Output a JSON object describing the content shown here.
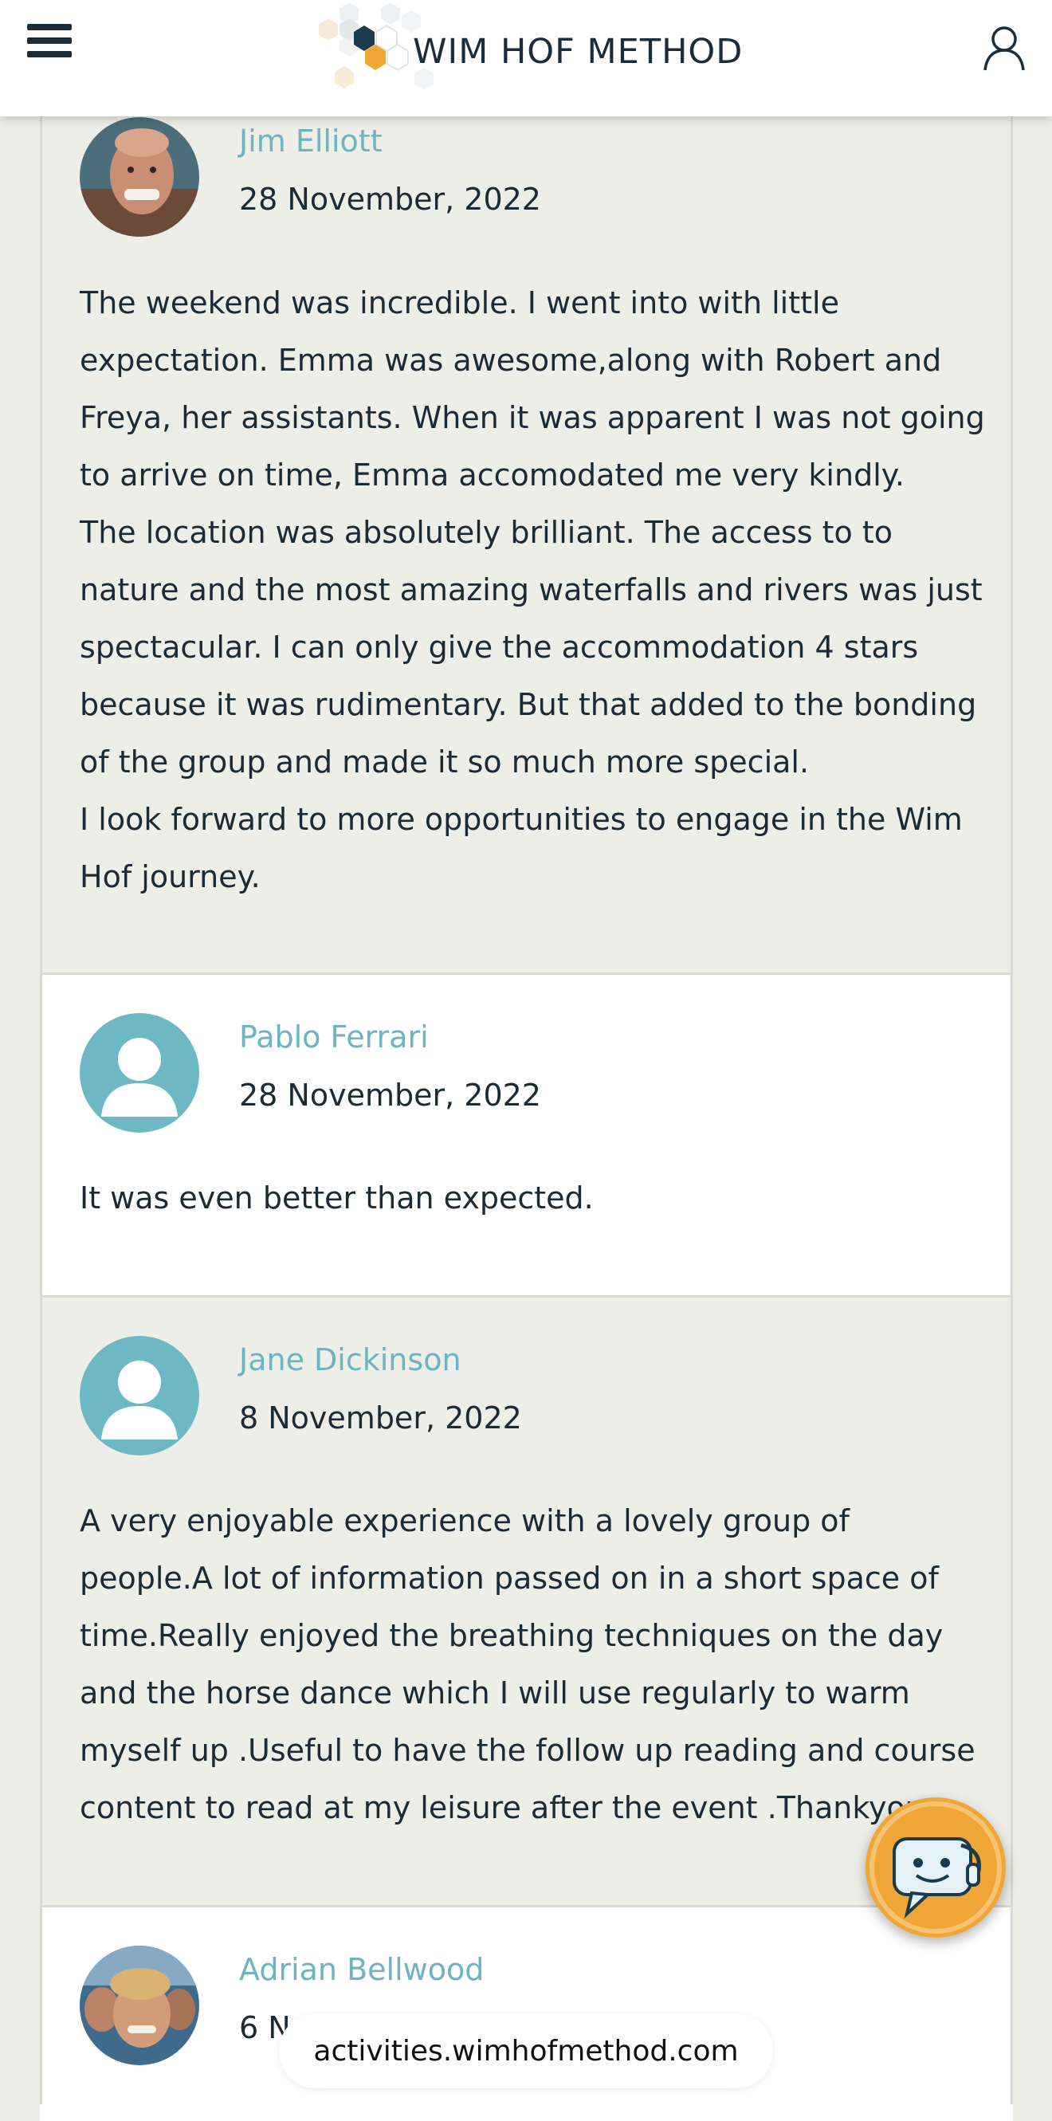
{
  "header": {
    "logo_text": "WIM HOF METHOD",
    "menu_icon": "hamburger-menu-icon",
    "account_icon": "user-icon",
    "colors": {
      "dark": "#1b2d3a",
      "accent": "#f0a537"
    }
  },
  "reviews": [
    {
      "name": "Jim Elliott",
      "date": "28 November, 2022",
      "avatar": "photo",
      "paragraphs": [
        "The weekend was incredible. I went into with little expectation. Emma was awesome,along with Robert and Freya, her assistants. When it was apparent I was not going to arrive on time, Emma accomodated me very kindly.",
        "The location was absolutely brilliant. The access to to nature and the most amazing waterfalls and rivers was just spectacular. I can only give the accommodation 4 stars because it was rudimentary. But that added to the bonding of the group and made it so much more special.",
        "I look forward to more opportunities to engage in the Wim Hof journey."
      ]
    },
    {
      "name": "Pablo Ferrari",
      "date": "28 November, 2022",
      "avatar": "default-user-icon",
      "paragraphs": [
        "It was even better than expected."
      ]
    },
    {
      "name": "Jane Dickinson",
      "date": "8 November, 2022",
      "avatar": "default-user-icon",
      "paragraphs": [
        "A very enjoyable experience with a lovely group of people.A lot of information passed on in a short space of time.Really enjoyed the breathing techniques on the day and the horse dance which I will use regularly to warm myself up .Useful to have the follow up reading and course content to read at my leisure after the event .Thankyou"
      ]
    },
    {
      "name": "Adrian Bellwood",
      "date": "6 N",
      "avatar": "photo",
      "paragraphs": []
    }
  ],
  "chat": {
    "icon": "chat-bot-icon"
  },
  "browser": {
    "url": "activities.wimhofmethod.com"
  }
}
